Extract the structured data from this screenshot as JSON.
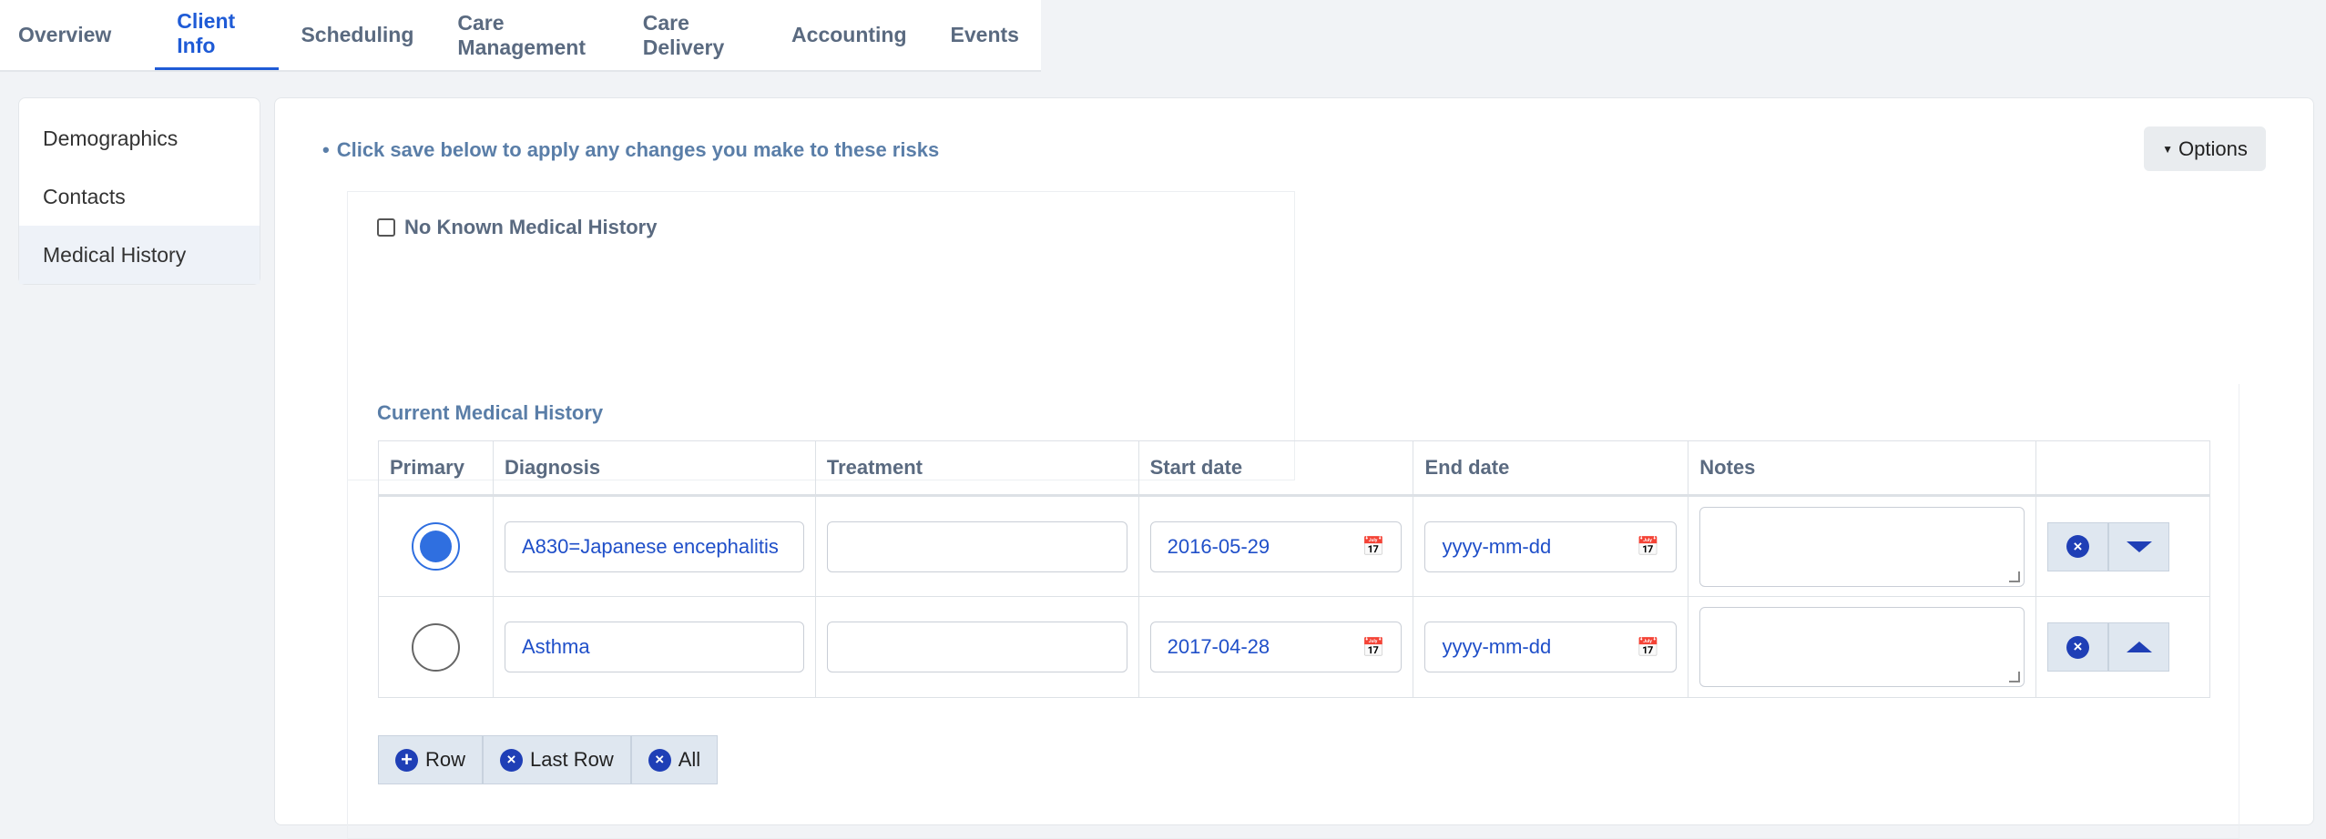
{
  "tabs": [
    {
      "label": "Overview"
    },
    {
      "label": "Client Info",
      "active": true
    },
    {
      "label": "Scheduling"
    },
    {
      "label": "Care Management"
    },
    {
      "label": "Care Delivery"
    },
    {
      "label": "Accounting"
    },
    {
      "label": "Events"
    }
  ],
  "sidebar": {
    "items": [
      {
        "label": "Demographics"
      },
      {
        "label": "Contacts"
      },
      {
        "label": "Medical History",
        "active": true
      }
    ]
  },
  "main": {
    "notice": "Click save below to apply any changes you make to these risks",
    "options_label": "Options",
    "no_known_label": "No Known Medical History",
    "section_title": "Current Medical History",
    "columns": [
      "Primary",
      "Diagnosis",
      "Treatment",
      "Start date",
      "End date",
      "Notes"
    ],
    "rows": [
      {
        "primary": true,
        "diagnosis": "A830=Japanese encephalitis",
        "treatment": "",
        "start": "2016-05-29",
        "end": "yyyy-mm-dd",
        "notes": ""
      },
      {
        "primary": false,
        "diagnosis": "Asthma",
        "treatment": "",
        "start": "2017-04-28",
        "end": "yyyy-mm-dd",
        "notes": ""
      }
    ],
    "bottom_buttons": {
      "add_row": "Row",
      "remove_last": "Last Row",
      "remove_all": "All"
    }
  },
  "colors": {
    "accent": "#1f5bd6",
    "icon_blue": "#1f3fb6"
  }
}
